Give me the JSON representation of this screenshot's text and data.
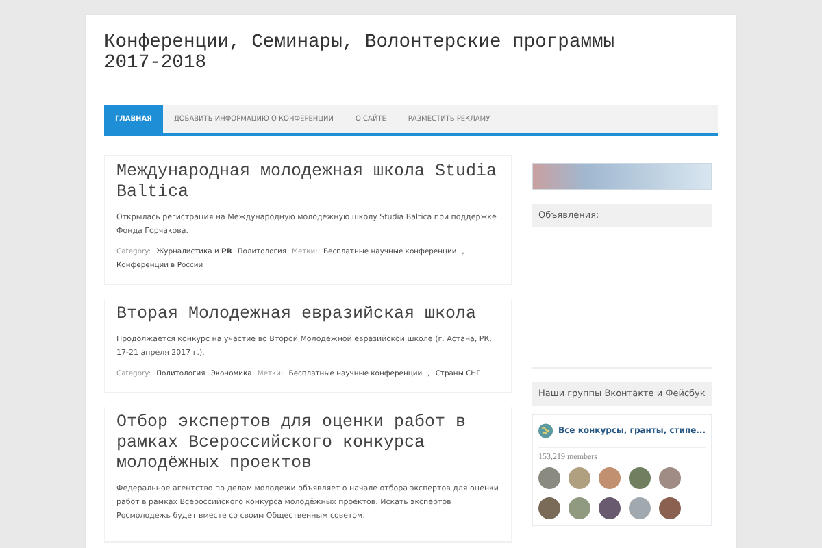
{
  "site_title": "Конференции, Семинары, Волонтерские программы 2017-2018",
  "nav": [
    {
      "label": "ГЛАВНАЯ",
      "selected": true
    },
    {
      "label": "ДОБАВИТЬ ИНФОРМАЦИЮ О КОНФЕРЕНЦИИ",
      "selected": false
    },
    {
      "label": "О САЙТЕ",
      "selected": false
    },
    {
      "label": "РАЗМЕСТИТЬ РЕКЛАМУ",
      "selected": false
    }
  ],
  "posts": [
    {
      "title": "Международная молодежная школа Studia Baltica",
      "excerpt": "Открылась регистрация на Международную молодежную школу Studia Baltica при поддержке Фонда Горчакова.",
      "category_label": "Category:",
      "categories": [
        "Журналистика и **PR**",
        "Политология"
      ],
      "tags_label": "Метки:",
      "tags": [
        "Бесплатные научные конференции",
        "Конференции в России"
      ],
      "tag_separator": ","
    },
    {
      "title": "Вторая Молодежная евразийская школа",
      "excerpt": "Продолжается конкурс на участие во Второй Молодежной евразийской школе (г. Астана, РК, 17-21 апреля 2017 г.).",
      "category_label": "Category:",
      "categories": [
        "Политология",
        "Экономика"
      ],
      "tags_label": "Метки:",
      "tags": [
        "Бесплатные научные конференции",
        "Страны СНГ"
      ],
      "tag_separator": ","
    },
    {
      "title": "Отбор экспертов для оценки работ в рамках Всероссийского конкурса молодёжных проектов",
      "excerpt": "Федеральное агентство по делам молодежи объявляет о начале отбора экспертов для оценки работ в рамках Всероссийского конкурса молодёжных проектов. Искать экспертов Росмолодежь будет вместе со своим Общественным советом."
    }
  ],
  "sidebar": {
    "ads_heading": "Объявления:",
    "groups_heading": "Наши группы Вконтакте и Фейсбук",
    "vk_widget": {
      "group_name": "Все конкурсы, гранты, стипе...",
      "members": "153,219 members"
    }
  }
}
